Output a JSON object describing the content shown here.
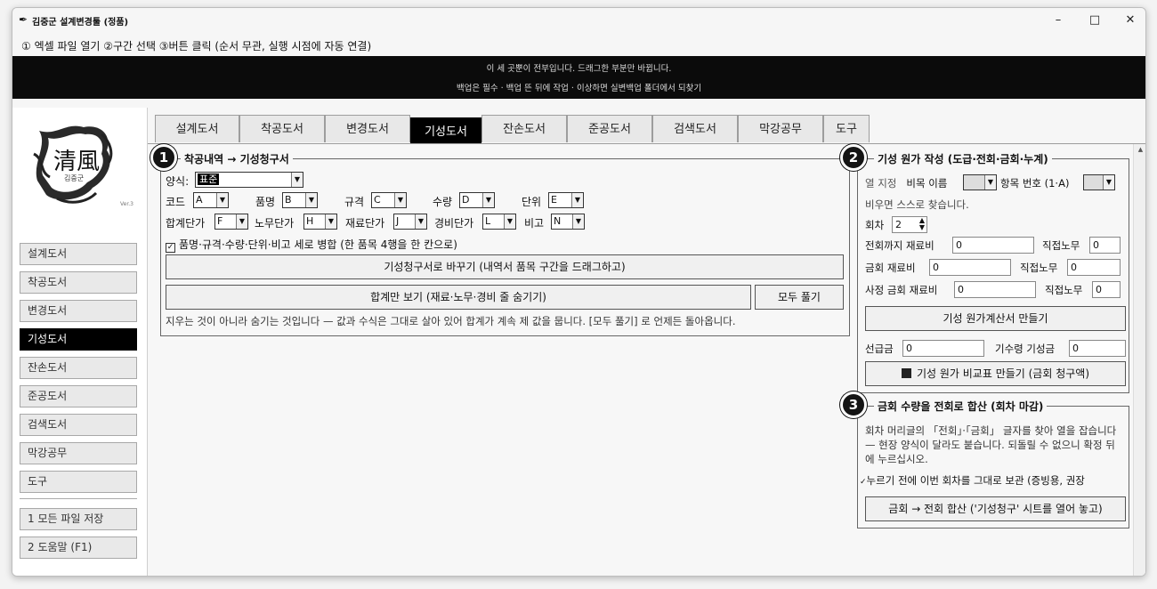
{
  "window": {
    "title": "김중군 설계변경툴 (정품)",
    "title_icon": "feather-icon",
    "controls": {
      "minimize": "–",
      "maximize": "□",
      "close": "✕"
    }
  },
  "steps_line": "① 엑셀 파일 열기  ②구간 선택  ③버튼 클릭 (순서 무관, 실행 시점에 자동 연결)",
  "banner": {
    "line1": "이 세 곳뿐이 전부입니다. 드래그한 부분만 바뀝니다.",
    "line2": "백업은 필수 · 백업 뜬 뒤에 작업 · 이상하면 실변백업 폴더에서 되찾기"
  },
  "logo": {
    "text": "清風",
    "sub": "김중군",
    "corner": "Ver.3"
  },
  "sidebar": {
    "items": [
      "설계도서",
      "착공도서",
      "변경도서",
      "기성도서",
      "잔손도서",
      "준공도서",
      "검색도서",
      "막강공무",
      "도구"
    ],
    "active": "기성도서",
    "bottom": [
      "1 모든 파일 저장",
      "2 도움말 (F1)"
    ]
  },
  "tabs": {
    "items": [
      "설계도서",
      "착공도서",
      "변경도서",
      "기성도서",
      "잔손도서",
      "준공도서",
      "검색도서",
      "막강공무",
      "도구"
    ],
    "active": "기성도서"
  },
  "panel1": {
    "badge": "1",
    "legend": "착공내역 → 기성청구서",
    "form_label": "양식:",
    "form_value": "표준",
    "row1": [
      {
        "label": "코드",
        "value": "A"
      },
      {
        "label": "품명",
        "value": "B"
      },
      {
        "label": "규격",
        "value": "C"
      },
      {
        "label": "수량",
        "value": "D"
      },
      {
        "label": "단위",
        "value": "E"
      }
    ],
    "row2": [
      {
        "label": "합계단가",
        "value": "F"
      },
      {
        "label": "노무단가",
        "value": "H"
      },
      {
        "label": "재료단가",
        "value": "J"
      },
      {
        "label": "경비단가",
        "value": "L"
      },
      {
        "label": "비고",
        "value": "N"
      }
    ],
    "merge_checkbox": "품명·규격·수량·단위·비고 세로 병합 (한 품목 4행을 한 칸으로)",
    "convert_button": "기성청구서로 바꾸기 (내역서 품목 구간을 드래그하고)",
    "totals_button": "합계만 보기 (재료·노무·경비 줄 숨기기)",
    "unhide_button": "모두 풀기",
    "note": "지우는 것이 아니라 숨기는 것입니다 — 값과 수식은 그대로 살아 있어 합계가 계속 제 값을 뭅니다. [모두 풀기] 로 언제든 돌아옵니다."
  },
  "panel2": {
    "badge": "2",
    "legend": "기성 원가 작성 (도급·전회·금회·누계)",
    "col_label": "열 지정",
    "cost_name_label": "비목 이름",
    "item_no_label": "항목 번호 (1·A)",
    "auto_hint": "비우면 스스로 찾습니다.",
    "round_label": "회차",
    "round_value": "2",
    "prev_material_label": "전회까지 재료비",
    "prev_material_value": "0",
    "prev_labor_label": "직접노무",
    "prev_labor_value": "0",
    "cur_material_label": "금회 재료비",
    "cur_material_value": "0",
    "cur_labor_label": "직접노무",
    "cur_labor_value": "0",
    "site_material_label": "사정 금회 재료비",
    "site_material_value": "0",
    "site_labor_label": "직접노무",
    "site_labor_value": "0",
    "make_calc_button": "기성 원가계산서 만들기",
    "advance_label": "선급금",
    "advance_value": "0",
    "prior_paid_label": "기수령 기성금",
    "prior_paid_value": "0",
    "compare_button": "기성 원가 비교표 만들기 (금회 청구액)"
  },
  "panel3": {
    "badge": "3",
    "legend": "금회 수량을 전회로 합산 (회차 마감)",
    "desc": "회차 머리글의 「전회」·「금회」 글자를 찾아 열을 잡습니다 — 현장 양식이 달라도 붙습니다. 되돌릴 수 없으니 확정 뒤에 누르십시오.",
    "keep_checkbox": "누르기 전에 이번 회차를 그대로 보관 (증빙용, 권장",
    "merge_button": "금회 → 전회 합산 ('기성청구' 시트를 열어 놓고)"
  }
}
